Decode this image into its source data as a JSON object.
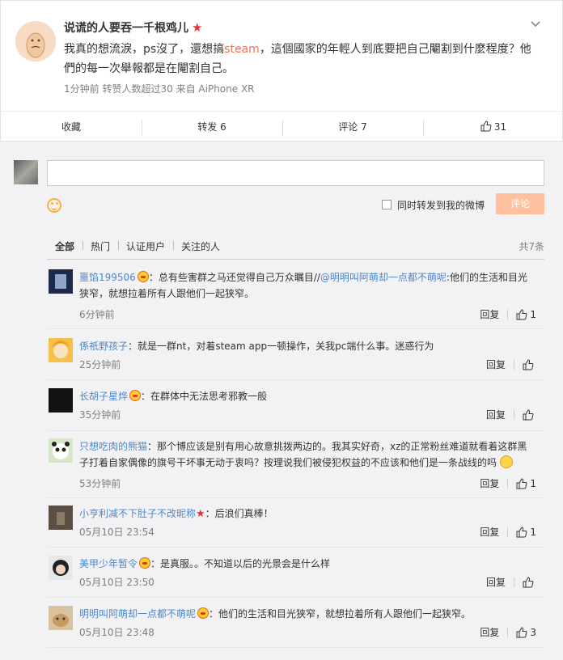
{
  "post": {
    "author": "说谎的人要吞一千根鸡儿",
    "text_before": "我真的想流淚，ps沒了，還想搞",
    "link": "steam",
    "text_after": "，這個國家的年輕人到底要把自己閹割到什麼程度？他們的每一次舉報都是在閹割自己。",
    "time": "1分钟前",
    "repost_info": "转赞人数超过30",
    "source_prefix": "来自",
    "source": "AiPhone XR"
  },
  "action_bar": {
    "collect": "收藏",
    "repost": "转发 6",
    "comment": "评论 7",
    "likes": "31"
  },
  "composer": {
    "placeholder": "",
    "forward_label": "同时转发到我的微博",
    "submit_label": "评论"
  },
  "tabs": {
    "items": [
      "全部",
      "热门",
      "认证用户",
      "关注的人"
    ],
    "count": "共7条"
  },
  "comments": [
    {
      "name": "噩馅199506",
      "text_before": "：总有些害群之马还觉得自己万众瞩目//",
      "mention": "@明明叫阿萌却一点都不萌呢",
      "text_after": ":他们的生活和目光狭窄，就想拉着所有人跟他们一起狭窄。",
      "time": "6分钟前",
      "reply": "回复",
      "likes": "1"
    },
    {
      "name": "係祇野孩子",
      "text": "：就是一群nt，对着steam app一顿操作，关我pc端什么事。迷惑行为",
      "time": "25分钟前",
      "reply": "回复",
      "likes": ""
    },
    {
      "name": "长胡子星烨",
      "text": "：在群体中无法思考邪教一般",
      "time": "35分钟前",
      "reply": "回复",
      "likes": ""
    },
    {
      "name": "只想吃肉的熊猫",
      "text": "：那个博应该是别有用心故意挑拨两边的。我其实好奇，xz的正常粉丝难道就看着这群黑子打着自家偶像的旗号干坏事无动于衷吗？按理说我们被侵犯权益的不应该和他们是一条战线的吗",
      "time": "53分钟前",
      "reply": "回复",
      "likes": "1"
    },
    {
      "name": "小亨利减不下肚子不改昵称",
      "text": "：后浪们真棒！",
      "time": "05月10日 23:54",
      "reply": "回复",
      "likes": "1"
    },
    {
      "name": "美甲少年暂令",
      "text": "：是真服。。不知道以后的光景会是什么样",
      "time": "05月10日 23:50",
      "reply": "回复",
      "likes": ""
    },
    {
      "name": "明明叫阿萌却一点都不萌呢",
      "text": "：他们的生活和目光狭窄，就想拉着所有人跟他们一起狭窄。",
      "time": "05月10日 23:48",
      "reply": "回复",
      "likes": "3"
    }
  ],
  "colors": {
    "accent": "#eb7350",
    "link_blue": "#4e87c7",
    "submit_bg": "#ffc09f"
  }
}
